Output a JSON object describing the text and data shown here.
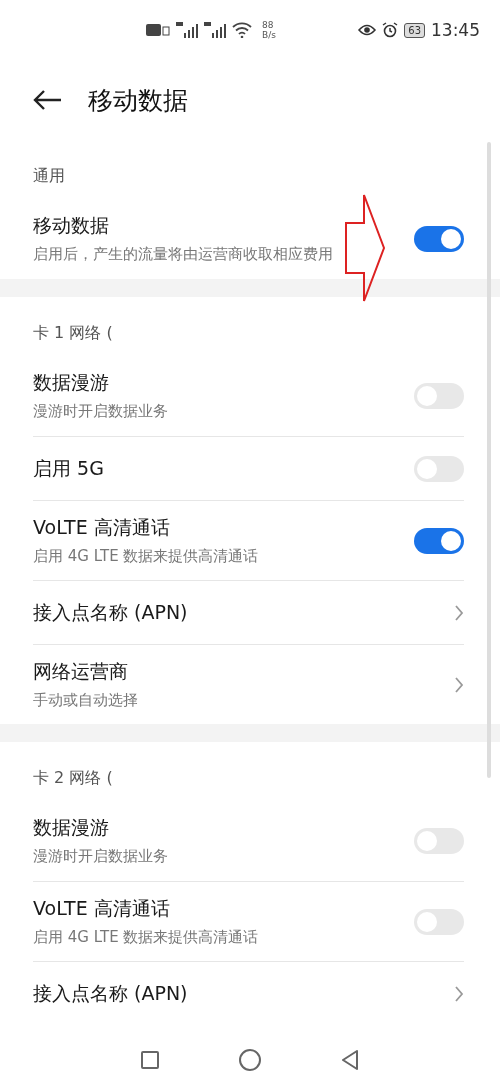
{
  "status_bar": {
    "speed_value": "88",
    "speed_unit": "B/s",
    "battery": "63",
    "time": "13:45"
  },
  "header": {
    "title": "移动数据"
  },
  "sections": [
    {
      "title": "通用",
      "items": [
        {
          "kind": "toggle",
          "title": "移动数据",
          "subtitle": "启用后，产生的流量将由运营商收取相应费用",
          "on": true
        }
      ]
    },
    {
      "title": "卡 1 网络 (",
      "items": [
        {
          "kind": "toggle",
          "title": "数据漫游",
          "subtitle": "漫游时开启数据业务",
          "on": false
        },
        {
          "kind": "toggle",
          "title": "启用 5G",
          "on": false
        },
        {
          "kind": "toggle",
          "title": "VoLTE 高清通话",
          "subtitle": "启用 4G LTE 数据来提供高清通话",
          "on": true
        },
        {
          "kind": "link",
          "title": "接入点名称 (APN)"
        },
        {
          "kind": "link",
          "title": "网络运营商",
          "subtitle": "手动或自动选择"
        }
      ]
    },
    {
      "title": "卡 2 网络 (",
      "items": [
        {
          "kind": "toggle",
          "title": "数据漫游",
          "subtitle": "漫游时开启数据业务",
          "on": false
        },
        {
          "kind": "toggle",
          "title": "VoLTE 高清通话",
          "subtitle": "启用 4G LTE 数据来提供高清通话",
          "on": false
        },
        {
          "kind": "link",
          "title": "接入点名称 (APN)"
        }
      ]
    }
  ]
}
